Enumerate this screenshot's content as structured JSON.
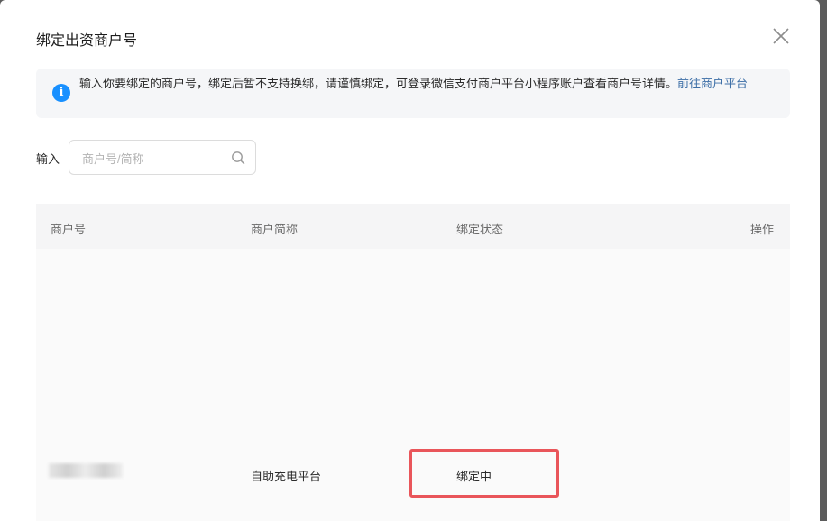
{
  "dialog": {
    "title": "绑定出资商户号"
  },
  "notice": {
    "text": "输入你要绑定的商户号，绑定后暂不支持换绑，请谨慎绑定，可登录微信支付商户平台小程序账户查看商户号详情。",
    "link_text": "前往商户平台",
    "icon": "info-icon"
  },
  "search": {
    "label": "输入",
    "placeholder": "商户号/简称",
    "value": ""
  },
  "table": {
    "headers": {
      "merchant_no": "商户号",
      "short_name": "商户简称",
      "status": "绑定状态",
      "action": "操作"
    },
    "rows": [
      {
        "short_name": "自助充电平台",
        "status": "绑定中"
      }
    ]
  },
  "colors": {
    "link": "#3d6fa7",
    "info_icon": "#1890ff",
    "highlight_border": "#e9555a",
    "overlay": "#5c5c5c"
  }
}
